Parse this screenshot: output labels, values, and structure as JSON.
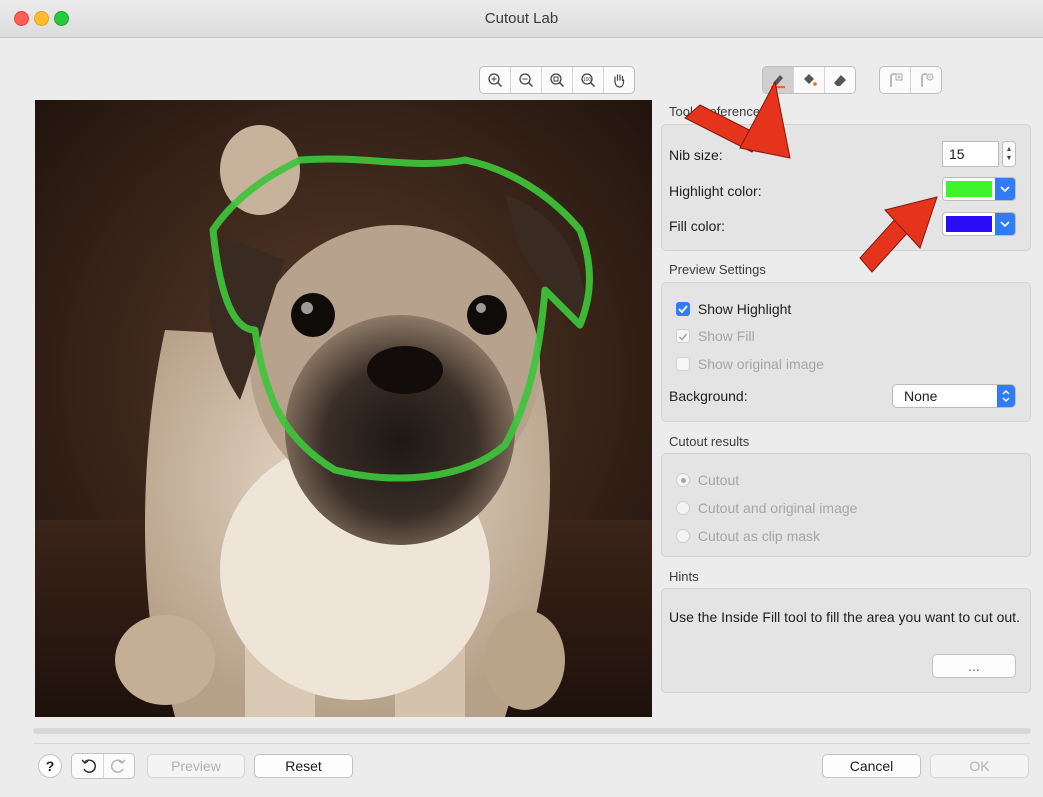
{
  "window": {
    "title": "Cutout Lab"
  },
  "toolbar": {
    "view_tools": [
      "zoom-in-icon",
      "zoom-out-icon",
      "zoom-fit-icon",
      "zoom-100-icon",
      "hand-icon"
    ],
    "edit_tools": [
      "highlighter-icon",
      "fill-bucket-icon",
      "eraser-icon"
    ],
    "extra_tools": [
      "add-mask-icon",
      "remove-mask-icon"
    ],
    "selected_tool": "highlighter-icon"
  },
  "tool_preferences": {
    "title": "Tool Preferences",
    "nib_size_label": "Nib size:",
    "nib_size_value": "15",
    "highlight_color_label": "Highlight color:",
    "highlight_color": "#3ef52c",
    "fill_color_label": "Fill color:",
    "fill_color": "#2b0df5"
  },
  "preview_settings": {
    "title": "Preview Settings",
    "show_highlight_label": "Show Highlight",
    "show_fill_label": "Show Fill",
    "show_original_label": "Show original image",
    "background_label": "Background:",
    "background_value": "None"
  },
  "cutout_results": {
    "title": "Cutout results",
    "options": [
      "Cutout",
      "Cutout and original image",
      "Cutout as clip mask"
    ]
  },
  "hints": {
    "title": "Hints",
    "text": "Use the Inside Fill tool to fill the area you want to cut out.",
    "more_label": "..."
  },
  "bottom": {
    "help_label": "?",
    "preview_label": "Preview",
    "reset_label": "Reset",
    "cancel_label": "Cancel",
    "ok_label": "OK"
  },
  "colors": {
    "accent": "#2f7cf6",
    "annotation_arrow": "#e6331c",
    "highlight_stroke": "#3ec43a"
  }
}
